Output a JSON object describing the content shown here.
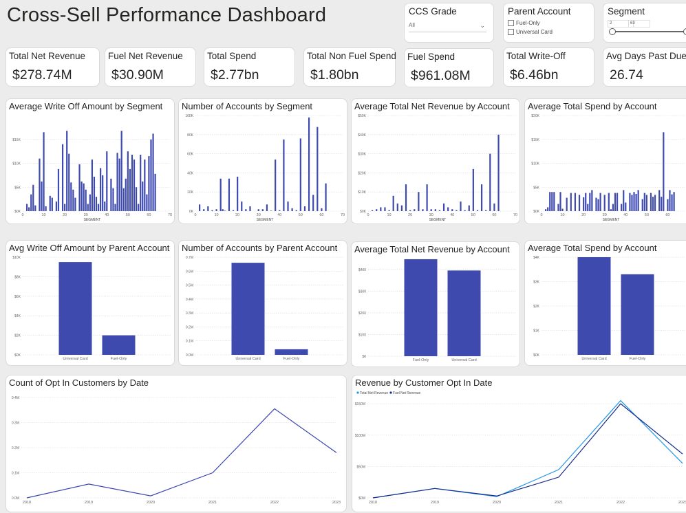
{
  "page": {
    "title": "Cross-Sell Performance Dashboard"
  },
  "slicers": {
    "ccs_grade": {
      "title": "CCS Grade",
      "value": "All"
    },
    "parent_account": {
      "title": "Parent Account",
      "options": [
        "Fuel-Only",
        "Universal Card"
      ]
    },
    "segment": {
      "title": "Segment",
      "min": "2",
      "max": "63"
    }
  },
  "kpis": [
    {
      "label": "Total Net Revenue",
      "value": "$278.74M"
    },
    {
      "label": "Fuel Net Revenue",
      "value": "$30.90M"
    },
    {
      "label": "Total Spend",
      "value": "$2.77bn"
    },
    {
      "label": "Total Non Fuel Spend",
      "value": "$1.80bn"
    },
    {
      "label": "Fuel Spend",
      "value": "$961.08M"
    },
    {
      "label": "Total Write-Off",
      "value": "$6.46bn"
    },
    {
      "label": "Avg Days Past Due",
      "value": "26.74"
    }
  ],
  "chart_data": [
    {
      "id": "c1",
      "type": "bar",
      "title": "Average Write Off Amount by Segment",
      "xlabel": "SEGMENT",
      "ylabel": "",
      "xlim": [
        0,
        70
      ],
      "xticks": [
        0,
        10,
        20,
        30,
        40,
        50,
        60,
        70
      ],
      "ylim": [
        0,
        20000
      ],
      "yticks": [
        0,
        5000,
        10000,
        15000
      ],
      "yticklabels": [
        "$0K",
        "$5K",
        "$10K",
        "$15K"
      ],
      "x": [
        2,
        3,
        4,
        5,
        6,
        8,
        9,
        10,
        11,
        13,
        14,
        16,
        17,
        19,
        20,
        21,
        22,
        23,
        24,
        25,
        27,
        28,
        29,
        30,
        31,
        32,
        33,
        34,
        35,
        36,
        37,
        38,
        39,
        40,
        42,
        43,
        44,
        45,
        46,
        47,
        48,
        49,
        50,
        51,
        52,
        53,
        54,
        55,
        56,
        57,
        58,
        59,
        60,
        61,
        62,
        63
      ],
      "values": [
        1500,
        800,
        3500,
        5500,
        1200,
        11000,
        6200,
        16500,
        1000,
        3200,
        2800,
        2000,
        8800,
        14000,
        1500,
        16800,
        12000,
        6000,
        4500,
        2800,
        9800,
        6200,
        5800,
        4500,
        1500,
        3500,
        10800,
        7200,
        3000,
        1500,
        9000,
        7500,
        2000,
        12500,
        6800,
        4800,
        1500,
        12200,
        11000,
        16800,
        4800,
        6800,
        12500,
        8800,
        11800,
        10800,
        5000,
        1500,
        11800,
        6200,
        10800,
        3500,
        11500,
        15000,
        16200,
        7800
      ]
    },
    {
      "id": "c2",
      "type": "bar",
      "title": "Number of Accounts by Segment",
      "xlabel": "SEGMENT",
      "ylabel": "",
      "xlim": [
        0,
        70
      ],
      "xticks": [
        0,
        10,
        20,
        30,
        40,
        50,
        60,
        70
      ],
      "ylim": [
        0,
        100000
      ],
      "yticks": [
        0,
        20000,
        40000,
        60000,
        80000,
        100000
      ],
      "yticklabels": [
        "0K",
        "20K",
        "40K",
        "60K",
        "80K",
        "100K"
      ],
      "x": [
        2,
        4,
        6,
        8,
        10,
        12,
        13,
        14,
        16,
        18,
        20,
        22,
        24,
        26,
        30,
        32,
        34,
        36,
        38,
        40,
        42,
        44,
        46,
        48,
        50,
        52,
        54,
        56,
        58,
        60,
        62
      ],
      "values": [
        7000,
        2000,
        5000,
        1000,
        2000,
        34000,
        2000,
        500,
        34000,
        1000,
        36000,
        10000,
        2000,
        5000,
        2000,
        2000,
        7000,
        500,
        54000,
        1000,
        75000,
        10000,
        3000,
        1000,
        76000,
        5000,
        98000,
        17000,
        88000,
        3000,
        29000
      ]
    },
    {
      "id": "c3",
      "type": "bar",
      "title": "Average Total Net Revenue by Account",
      "xlabel": "SEGMENT",
      "ylabel": "",
      "xlim": [
        0,
        70
      ],
      "xticks": [
        0,
        10,
        20,
        30,
        40,
        50,
        60,
        70
      ],
      "ylim": [
        0,
        50000
      ],
      "yticks": [
        0,
        10000,
        20000,
        30000,
        40000,
        50000
      ],
      "yticklabels": [
        "$0K",
        "$10K",
        "$20K",
        "$30K",
        "$40K",
        "$50K"
      ],
      "x": [
        2,
        4,
        6,
        8,
        10,
        12,
        14,
        16,
        18,
        20,
        22,
        24,
        26,
        28,
        30,
        32,
        34,
        36,
        38,
        40,
        42,
        44,
        46,
        48,
        50,
        52,
        54,
        56,
        58,
        60,
        62
      ],
      "values": [
        500,
        1000,
        2000,
        2000,
        500,
        8000,
        4000,
        3000,
        14000,
        500,
        1000,
        10000,
        1000,
        14000,
        1000,
        1000,
        500,
        4000,
        2000,
        1000,
        500,
        5000,
        500,
        3000,
        22000,
        500,
        14000,
        500,
        30000,
        4000,
        40000
      ]
    },
    {
      "id": "c4",
      "type": "bar",
      "title": "Average Total Spend by Account",
      "xlabel": "SEGMENT",
      "ylabel": "",
      "xlim": [
        0,
        70
      ],
      "xticks": [
        0,
        10,
        20,
        30,
        40,
        50,
        60,
        70
      ],
      "ylim": [
        0,
        20000
      ],
      "yticks": [
        0,
        5000,
        10000,
        15000,
        20000
      ],
      "yticklabels": [
        "$0K",
        "$5K",
        "$10K",
        "$15K",
        "$20K"
      ],
      "x": [
        2,
        3,
        4,
        5,
        6,
        8,
        9,
        10,
        12,
        14,
        16,
        18,
        20,
        21,
        22,
        23,
        24,
        26,
        27,
        28,
        30,
        32,
        33,
        34,
        35,
        36,
        38,
        39,
        40,
        42,
        43,
        44,
        45,
        46,
        48,
        49,
        50,
        52,
        53,
        54,
        56,
        57,
        58,
        60,
        61,
        62,
        63
      ],
      "values": [
        400,
        800,
        4000,
        4000,
        4000,
        1500,
        4000,
        500,
        2800,
        3800,
        3800,
        3400,
        2900,
        3800,
        1500,
        3800,
        4400,
        2800,
        2500,
        3800,
        3400,
        3800,
        400,
        1500,
        3800,
        3800,
        1500,
        4400,
        1800,
        3800,
        3400,
        4000,
        3600,
        4400,
        2500,
        3800,
        3400,
        3800,
        3000,
        3400,
        4400,
        3000,
        16500,
        2500,
        4400,
        3500,
        4000
      ]
    },
    {
      "id": "c5",
      "type": "bar",
      "title": "Avg Write Off Amount by Parent Account",
      "categories": [
        "Universal Card",
        "Fuel-Only"
      ],
      "values": [
        9500,
        2000
      ],
      "ylim": [
        0,
        10000
      ],
      "yticks": [
        0,
        2000,
        4000,
        6000,
        8000,
        10000
      ],
      "yticklabels": [
        "$0K",
        "$2K",
        "$4K",
        "$6K",
        "$8K",
        "$10K"
      ]
    },
    {
      "id": "c6",
      "type": "bar",
      "title": "Number of Accounts by Parent Account",
      "categories": [
        "Universal Card",
        "Fuel-Only"
      ],
      "values": [
        660000,
        40000
      ],
      "ylim": [
        0,
        700000
      ],
      "yticks": [
        0,
        100000,
        200000,
        300000,
        400000,
        500000,
        600000,
        700000
      ],
      "yticklabels": [
        "0.0M",
        "0.1M",
        "0.2M",
        "0.3M",
        "0.4M",
        "0.5M",
        "0.6M",
        "0.7M"
      ]
    },
    {
      "id": "c7",
      "type": "bar",
      "title": "Average Total Net Revenue by Account",
      "categories": [
        "Fuel-Only",
        "Universal Card"
      ],
      "values": [
        447,
        395
      ],
      "ylim": [
        0,
        450
      ],
      "yticks": [
        0,
        100,
        200,
        300,
        400
      ],
      "yticklabels": [
        "$0",
        "$100",
        "$200",
        "$300",
        "$400"
      ]
    },
    {
      "id": "c8",
      "type": "bar",
      "title": "Average Total Spend by Account",
      "categories": [
        "Universal Card",
        "Fuel-Only"
      ],
      "values": [
        4000,
        3300
      ],
      "ylim": [
        0,
        4000
      ],
      "yticks": [
        0,
        1000,
        2000,
        3000,
        4000
      ],
      "yticklabels": [
        "$0K",
        "$1K",
        "$2K",
        "$3K",
        "$4K"
      ]
    },
    {
      "id": "c9",
      "type": "line",
      "title": "Count of Opt In Customers by Date",
      "x": [
        "2018",
        "2019",
        "2020",
        "2021",
        "2022",
        "2023"
      ],
      "values": [
        0,
        55000,
        8000,
        100000,
        355000,
        180000
      ],
      "ylim": [
        0,
        400000
      ],
      "yticks": [
        0,
        100000,
        200000,
        300000,
        400000
      ],
      "yticklabels": [
        "0.0M",
        "0.1M",
        "0.2M",
        "0.3M",
        "0.4M"
      ],
      "colors": [
        "#3b45b0"
      ]
    },
    {
      "id": "c10",
      "type": "line",
      "title": "Revenue by Customer Opt In Date",
      "x": [
        "2018",
        "2019",
        "2020",
        "2021",
        "2022",
        "2023"
      ],
      "series": [
        {
          "name": "Total Net Revenue",
          "values": [
            0,
            15000000,
            2000000,
            45000000,
            155000000,
            55000000
          ]
        },
        {
          "name": "Fuel Net Revenue",
          "values": [
            0,
            15000000,
            3000000,
            33000000,
            150000000,
            70000000
          ]
        }
      ],
      "ylim": [
        0,
        160000000
      ],
      "yticks": [
        0,
        50000000,
        100000000,
        150000000
      ],
      "yticklabels": [
        "$0M",
        "$50M",
        "$100M",
        "$150M"
      ],
      "colors": [
        "#2596e8",
        "#152b8a"
      ]
    }
  ]
}
